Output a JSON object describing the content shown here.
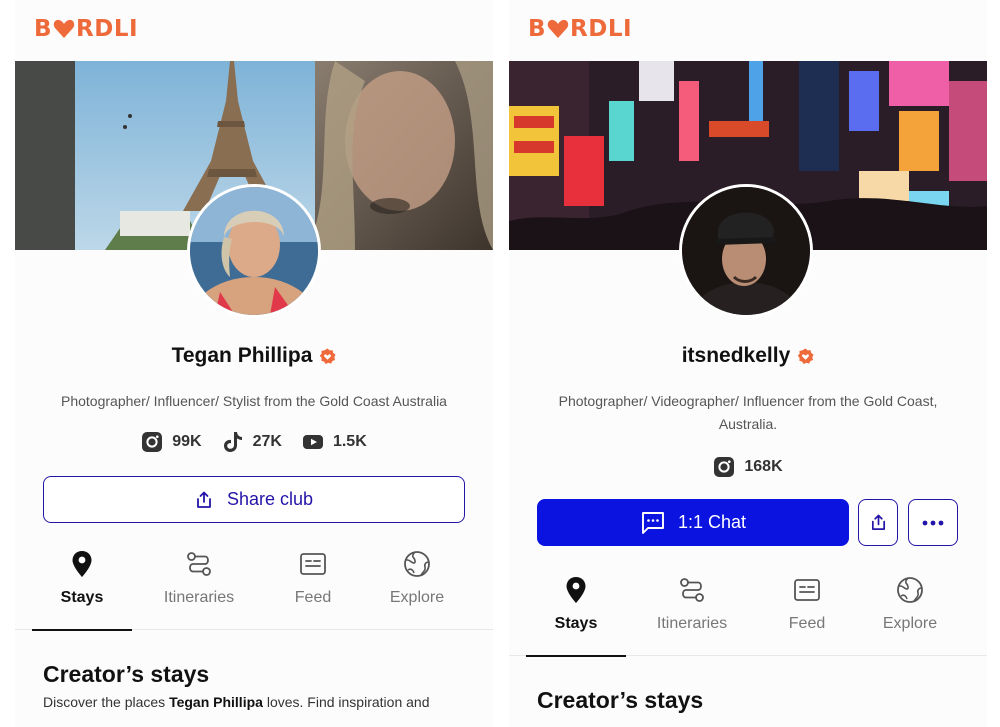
{
  "brand": {
    "name": "BIRDLI",
    "color": "#ee6a3a",
    "accent": "#2415a8",
    "chat_bg": "#0a13e0"
  },
  "profiles": [
    {
      "name": "Tegan Phillipa",
      "verified_icon": "verified-badge-icon",
      "bio": "Photographer/ Influencer/ Stylist from the Gold Coast Australia",
      "stats": [
        {
          "icon": "instagram-icon",
          "value": "99K"
        },
        {
          "icon": "tiktok-icon",
          "value": "27K"
        },
        {
          "icon": "youtube-icon",
          "value": "1.5K"
        }
      ],
      "share_label": "Share club",
      "tabs": [
        "Stays",
        "Itineraries",
        "Feed",
        "Explore"
      ],
      "active_tab": "Stays",
      "section_title": "Creator’s stays",
      "section_desc_prefix": "Discover the places ",
      "section_desc_name": "Tegan Phillipa",
      "section_desc_suffix": " loves. Find inspiration and"
    },
    {
      "name": "itsnedkelly",
      "verified_icon": "verified-badge-icon",
      "bio": "Photographer/ Videographer/ Influencer from the Gold Coast, Australia.",
      "stats": [
        {
          "icon": "instagram-icon",
          "value": "168K"
        }
      ],
      "chat_label": "1:1 Chat",
      "tabs": [
        "Stays",
        "Itineraries",
        "Feed",
        "Explore"
      ],
      "active_tab": "Stays",
      "section_title": "Creator’s stays"
    }
  ]
}
